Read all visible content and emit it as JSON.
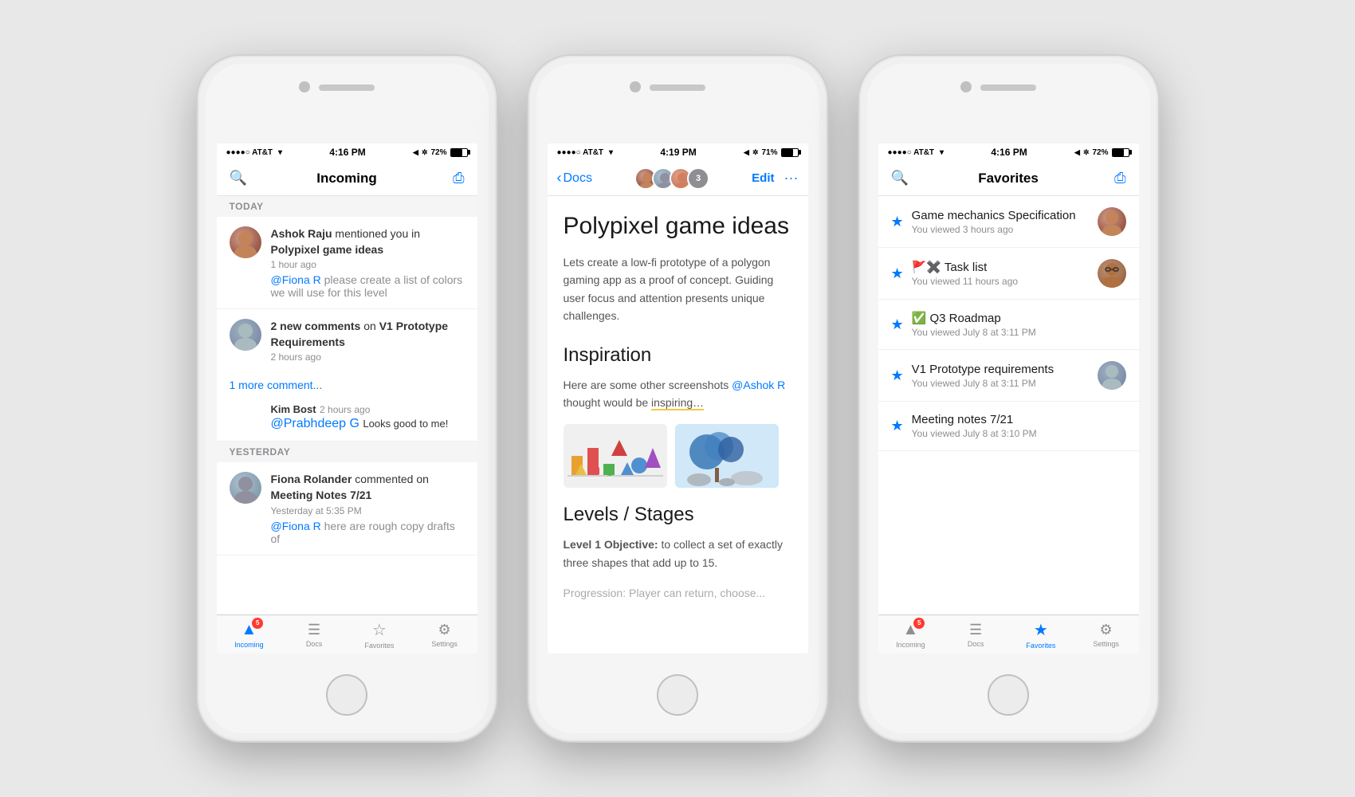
{
  "phone1": {
    "status": {
      "carrier": "●●●●○ AT&T",
      "wifi": "WiFi",
      "time": "4:16 PM",
      "battery": "72%"
    },
    "nav": {
      "title": "Incoming",
      "back_icon": "🔍",
      "action_icon": "✏️"
    },
    "today_label": "TODAY",
    "yesterday_label": "YESTERDAY",
    "notifications": [
      {
        "user": "Ashok Raju",
        "action": "mentioned you in",
        "doc": "Polypixel game ideas",
        "time": "1 hour ago",
        "comment": "@Fiona R please create a list of colors we will use for this level"
      },
      {
        "count": "2",
        "action": "new comments on",
        "doc": "V1 Prototype Requirements",
        "time": "2 hours ago",
        "more": "1 more comment...",
        "sub_user": "Kim Bost",
        "sub_time": "2 hours ago",
        "sub_comment": "@Prabhdeep G Looks good to me!"
      },
      {
        "user": "Fiona Rolander",
        "action": "commented on",
        "doc": "Meeting Notes 7/21",
        "time": "Yesterday at 5:35 PM",
        "comment": "@Fiona R here are rough copy drafts of"
      }
    ],
    "tabs": [
      {
        "icon": "🔔",
        "label": "Incoming",
        "active": true,
        "badge": "5"
      },
      {
        "icon": "📄",
        "label": "Docs",
        "active": false,
        "badge": ""
      },
      {
        "icon": "★",
        "label": "Favorites",
        "active": false,
        "badge": ""
      },
      {
        "icon": "⚙",
        "label": "Settings",
        "active": false,
        "badge": ""
      }
    ]
  },
  "phone2": {
    "status": {
      "carrier": "●●●●○ AT&T",
      "wifi": "WiFi",
      "time": "4:19 PM",
      "battery": "71%"
    },
    "nav": {
      "back_label": "Docs",
      "edit_label": "Edit",
      "more_icon": "···",
      "participant_count": "3"
    },
    "doc": {
      "title": "Polypixel game ideas",
      "subtitle": "Lets create a low-fi prototype of a polygon gaming app as a proof of concept. Guiding user focus and attention presents unique challenges.",
      "section1_title": "Inspiration",
      "section1_text": "Here are some other screenshots @Ashok R thought would be inspiring…",
      "section2_title": "Levels / Stages",
      "section2_text": "Level 1 Objective: to collect a set of exactly three shapes that add up to 15.",
      "section2_sub": "Progression: Player can return, choose..."
    }
  },
  "phone3": {
    "status": {
      "carrier": "●●●●○ AT&T",
      "wifi": "WiFi",
      "time": "4:16 PM",
      "battery": "72%"
    },
    "nav": {
      "title": "Favorites",
      "search_icon": "🔍",
      "action_icon": "✏️"
    },
    "favorites": [
      {
        "title": "Game mechanics Specification",
        "subtitle": "You viewed 3 hours ago",
        "emoji": ""
      },
      {
        "title": "🚩✖️ Task list",
        "subtitle": "You viewed 11 hours ago",
        "emoji": ""
      },
      {
        "title": "✅ Q3 Roadmap",
        "subtitle": "You viewed July 8 at 3:11 PM",
        "emoji": ""
      },
      {
        "title": "V1 Prototype requirements",
        "subtitle": "You viewed July 8 at 3:11 PM",
        "emoji": ""
      },
      {
        "title": "Meeting notes 7/21",
        "subtitle": "You viewed July 8 at 3:10 PM",
        "emoji": ""
      }
    ],
    "tabs": [
      {
        "icon": "🔔",
        "label": "Incoming",
        "active": false,
        "badge": "5"
      },
      {
        "icon": "📄",
        "label": "Docs",
        "active": false,
        "badge": ""
      },
      {
        "icon": "★",
        "label": "Favorites",
        "active": true,
        "badge": ""
      },
      {
        "icon": "⚙",
        "label": "Settings",
        "active": false,
        "badge": ""
      }
    ]
  }
}
